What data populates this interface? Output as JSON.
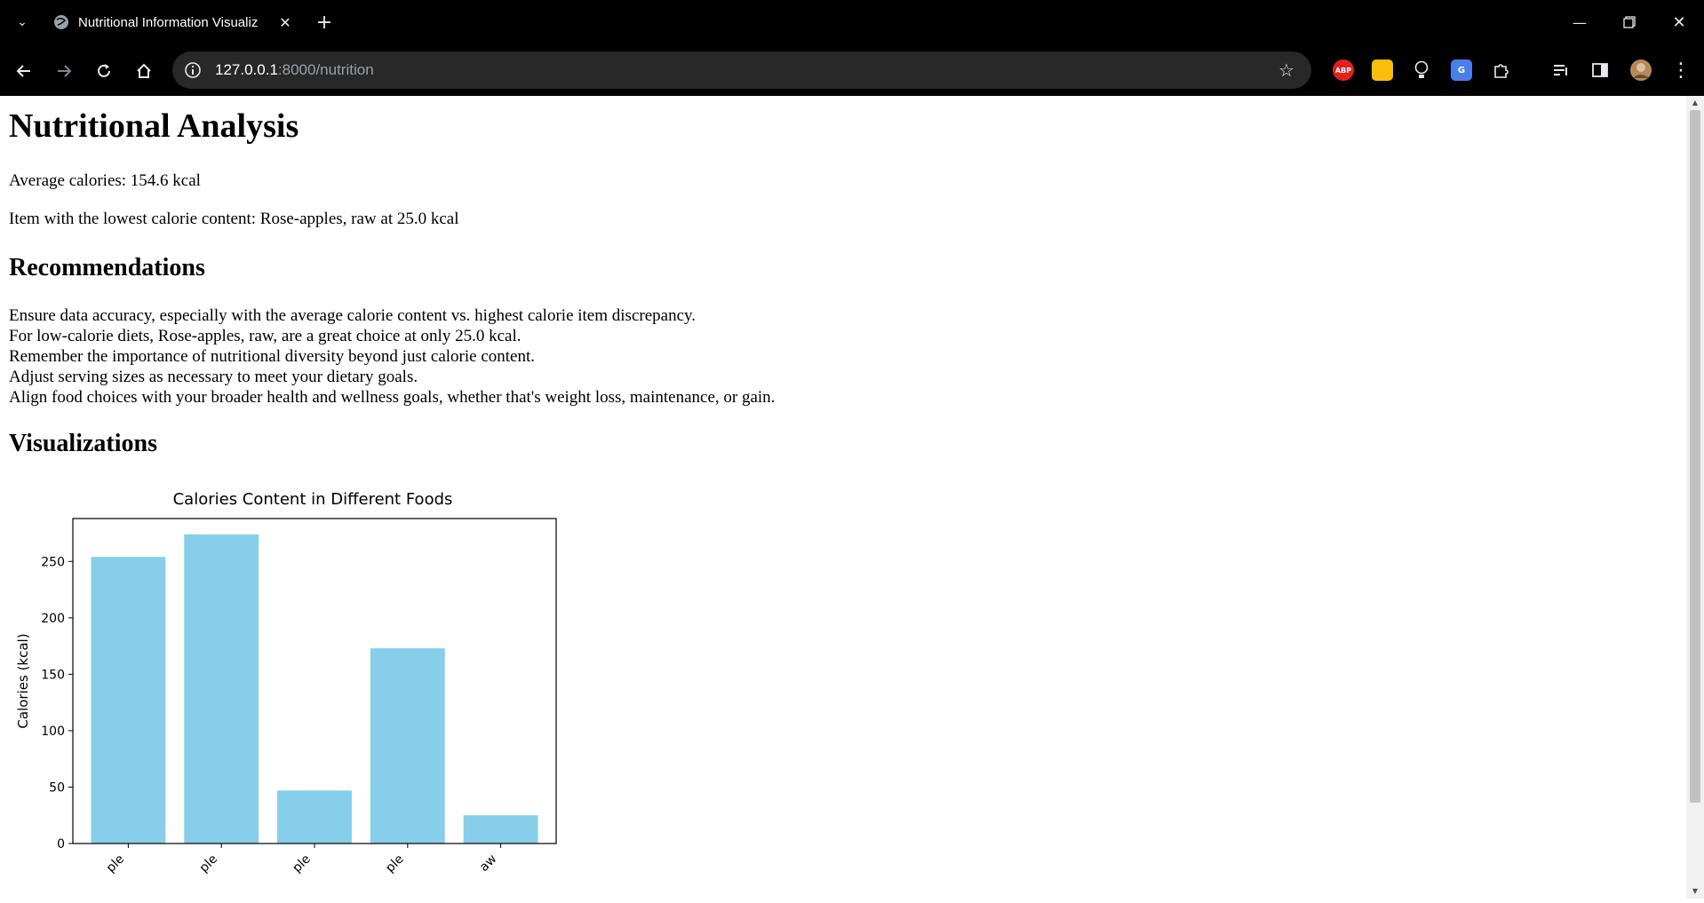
{
  "browser": {
    "tab_title": "Nutritional Information Visualiz",
    "url_host": "127.0.0.1",
    "url_path": ":8000/nutrition",
    "extensions": [
      "adblock-plus-icon",
      "notes-icon",
      "lightbulb-icon",
      "translate-icon",
      "puzzle-icon"
    ],
    "ext_abp_label": "ABP"
  },
  "page": {
    "title": "Nutritional Analysis",
    "average": "Average calories: 154.6 kcal",
    "lowest": "Item with the lowest calorie content: Rose-apples, raw at 25.0 kcal",
    "recommendations_heading": "Recommendations",
    "recommendations": [
      "Ensure data accuracy, especially with the average calorie content vs. highest calorie item discrepancy.",
      "For low-calorie diets, Rose-apples, raw, are a great choice at only 25.0 kcal.",
      "Remember the importance of nutritional diversity beyond just calorie content.",
      "Adjust serving sizes as necessary to meet your dietary goals.",
      "Align food choices with your broader health and wellness goals, whether that's weight loss, maintenance, or gain."
    ],
    "visualizations_heading": "Visualizations"
  },
  "chart_data": {
    "type": "bar",
    "title": "Calories Content in Different Foods",
    "xlabel": "",
    "ylabel": "Calories (kcal)",
    "categories": [
      "ple",
      "ple",
      "ple",
      "ple",
      "aw"
    ],
    "values": [
      254,
      274,
      47,
      173,
      25
    ],
    "ylim": [
      0,
      288
    ],
    "yticks": [
      0,
      50,
      100,
      150,
      200,
      250
    ],
    "bar_color": "#87ceeb",
    "grid": false
  }
}
